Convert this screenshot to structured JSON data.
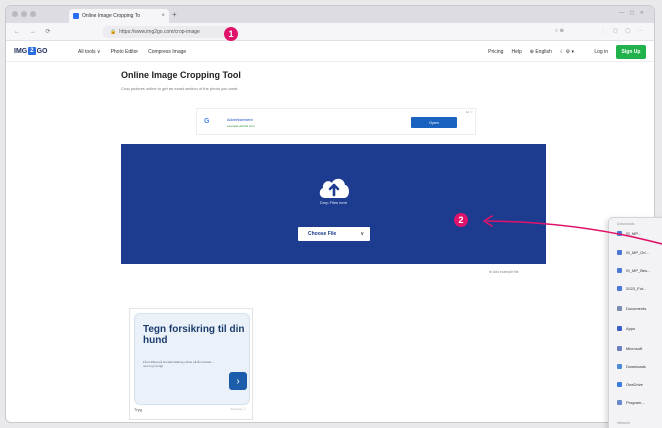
{
  "browser": {
    "tab_title": "Online Image Cropping To",
    "tab_close": "×",
    "new_tab": "+",
    "window_controls": "— ▢ ✕",
    "nav_icons": "← → ⟳",
    "url_lock": "🔒",
    "url": "https://www.img2go.com/crop-image",
    "toolbar_right": "☆ ⊕",
    "extensions": "⋮ ▢ ◯ ⋯"
  },
  "header": {
    "logo_left": "IMG",
    "logo_mid": "2",
    "logo_right": "GO",
    "nav": [
      "All tools ∨",
      "Photo Editor",
      "Compress Image"
    ],
    "right_nav": [
      "Pricing",
      "Help",
      "⊕ English",
      "☾ ⚙ ▾"
    ],
    "login": "Log in",
    "signup": "Sign Up"
  },
  "main": {
    "title": "Online Image Cropping Tool",
    "subtitle": "Crop pictures online to get an exact section of the photo you want."
  },
  "ad_banner": {
    "logo": "G",
    "title": "Advertisement",
    "url": "example-ad-link.com",
    "button": "Open",
    "mark": "Ad ⓘ"
  },
  "upload": {
    "drop_text": "Drop Files here",
    "choose_label": "Choose File",
    "chevron": "∨",
    "attribution": "⊕ Add example file"
  },
  "ad_card": {
    "headline": "Tegn forsikring til din hund",
    "body": "Få et tilbud på hundeforsikring online på få minutter – nemt og hurtigt",
    "arrow": "›",
    "foot_left": "Tryg",
    "foot_right": "Annonce ⓘ"
  },
  "context_panel": {
    "header": "Downloads",
    "items": [
      {
        "label": "IS_MP...",
        "color": "#4a78d6"
      },
      {
        "label": "IS_MP_Ori...",
        "color": "#4a78d6"
      },
      {
        "label": "IS_MP_Bes...",
        "color": "#4a78d6"
      },
      {
        "label": "2023_Fot...",
        "color": "#4a78d6"
      },
      {
        "label": "Documents",
        "color": "#7a8cb0"
      },
      {
        "label": "Apps",
        "color": "#3a5fc8"
      },
      {
        "label": "Microsoft",
        "color": "#6b7ec0"
      },
      {
        "label": "Downloads",
        "color": "#4a8ad6"
      },
      {
        "label": "OneDrive",
        "color": "#3a7be0"
      },
      {
        "label": "Program...",
        "color": "#6a88cc"
      }
    ],
    "footer": "Network"
  },
  "annotations": {
    "badge1": "1",
    "badge2": "2",
    "color": "#e0136b"
  },
  "colors": {
    "upload_bg": "#1d3c8f",
    "signup_bg": "#22b24c",
    "accent": "#2b6ce0"
  }
}
